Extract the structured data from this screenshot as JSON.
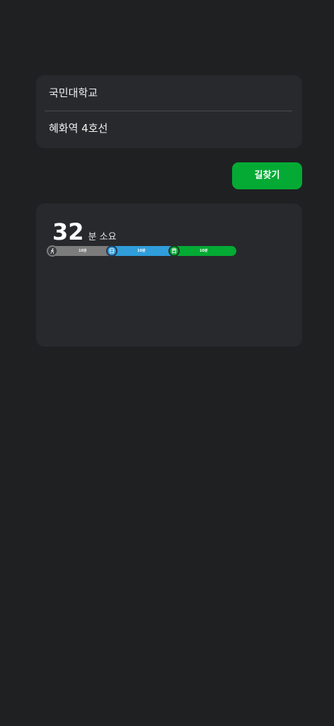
{
  "route": {
    "origin": "국민대학교",
    "destination": "혜화역 4호선"
  },
  "search_button": {
    "label": "길찾기",
    "color": "#04aa34"
  },
  "result": {
    "duration_value": "32",
    "duration_unit": "분 소요",
    "segments": [
      {
        "type": "walk",
        "icon": "walking-person-icon",
        "label": "10분",
        "color": "#7c7c7c"
      },
      {
        "type": "transit",
        "icon": "bus-icon",
        "label": "10분",
        "color": "#2f9edb"
      },
      {
        "type": "transit",
        "icon": "subway-train-icon",
        "label": "10분",
        "color": "#04aa34"
      }
    ]
  }
}
